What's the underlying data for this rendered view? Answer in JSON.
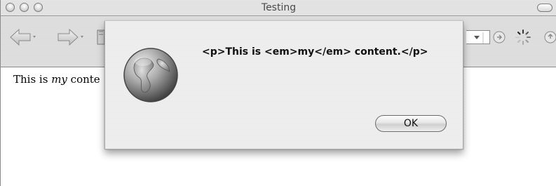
{
  "window": {
    "title": "Testing"
  },
  "page": {
    "text_before": "This is ",
    "text_em": "my",
    "text_after": " conte"
  },
  "dialog": {
    "message": "<p>This is <em>my</em> content.</p>",
    "ok_label": "OK",
    "icon": "globe-icon"
  },
  "toolbar": {
    "icons": [
      "back-icon",
      "forward-icon",
      "bookmark-icon",
      "dropdown-icon",
      "go-icon",
      "spinner-icon",
      "snapback-icon"
    ]
  }
}
